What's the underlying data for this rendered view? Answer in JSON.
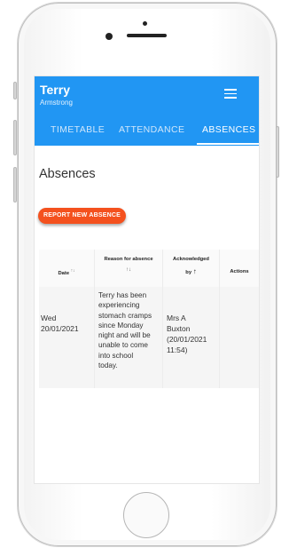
{
  "header": {
    "user_first_name": "Terry",
    "user_last_name": "Armstrong",
    "tabs": [
      {
        "label": "TIMETABLE"
      },
      {
        "label": "ATTENDANCE"
      },
      {
        "label": "ABSENCES"
      }
    ],
    "active_tab": "ABSENCES",
    "background_color": "#2196f3"
  },
  "main": {
    "title": "Absences",
    "report_button_label": "REPORT NEW ABSENCE",
    "report_button_color": "#f4511e"
  },
  "table": {
    "columns": [
      {
        "label": "Date",
        "sort_icon": "↑↓"
      },
      {
        "label": "Reason for absence",
        "sort_icon": "↑↓"
      },
      {
        "label": "Acknowledged",
        "label_line2": "by",
        "sort_icon": "↑"
      },
      {
        "label": "Actions"
      }
    ],
    "rows": [
      {
        "date_lines": [
          "Wed",
          "20/01/2021"
        ],
        "reason_lines": [
          "Terry has been",
          "experiencing",
          "stomach cramps",
          "since Monday",
          "night and will be",
          "unable to come",
          "into school",
          "today."
        ],
        "acknowledged_lines": [
          "Mrs A",
          "Buxton",
          "(20/01/2021",
          "11:54)"
        ],
        "actions": ""
      }
    ]
  },
  "icons": {
    "menu": "hamburger-menu-icon",
    "sort": "sort-icon"
  }
}
